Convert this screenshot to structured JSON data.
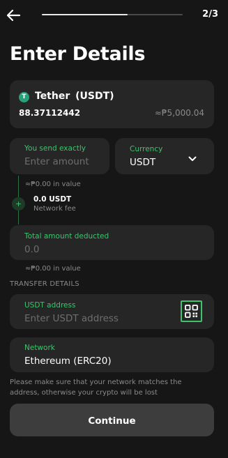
{
  "header": {
    "step": "2/3",
    "progress": 0.61
  },
  "title": "Enter Details",
  "asset": {
    "name": "Tether",
    "symbol": "(USDT)",
    "balance": "88.37112442",
    "fiat_value": "≈₱5,000.04",
    "icon": "tether-icon"
  },
  "send": {
    "label": "You send exactly",
    "placeholder": "Enter amount"
  },
  "currency": {
    "label": "Currency",
    "value": "USDT"
  },
  "value_note_1": "≈₱0.00 in value",
  "fee": {
    "amount": "0.0 USDT",
    "label": "Network fee"
  },
  "total": {
    "label": "Total amount deducted",
    "value": "0.0"
  },
  "value_note_2": "≈₱0.00 in value",
  "section_title": "TRANSFER DETAILS",
  "address": {
    "label": "USDT address",
    "placeholder": "Enter USDT address"
  },
  "network": {
    "label": "Network",
    "value": "Ethereum (ERC20)"
  },
  "warning": "Please make sure that your network matches the address, otherwise your crypto will be lost",
  "continue_label": "Continue",
  "colors": {
    "accent": "#3ec46d",
    "background": "#161616",
    "card": "#262626"
  }
}
